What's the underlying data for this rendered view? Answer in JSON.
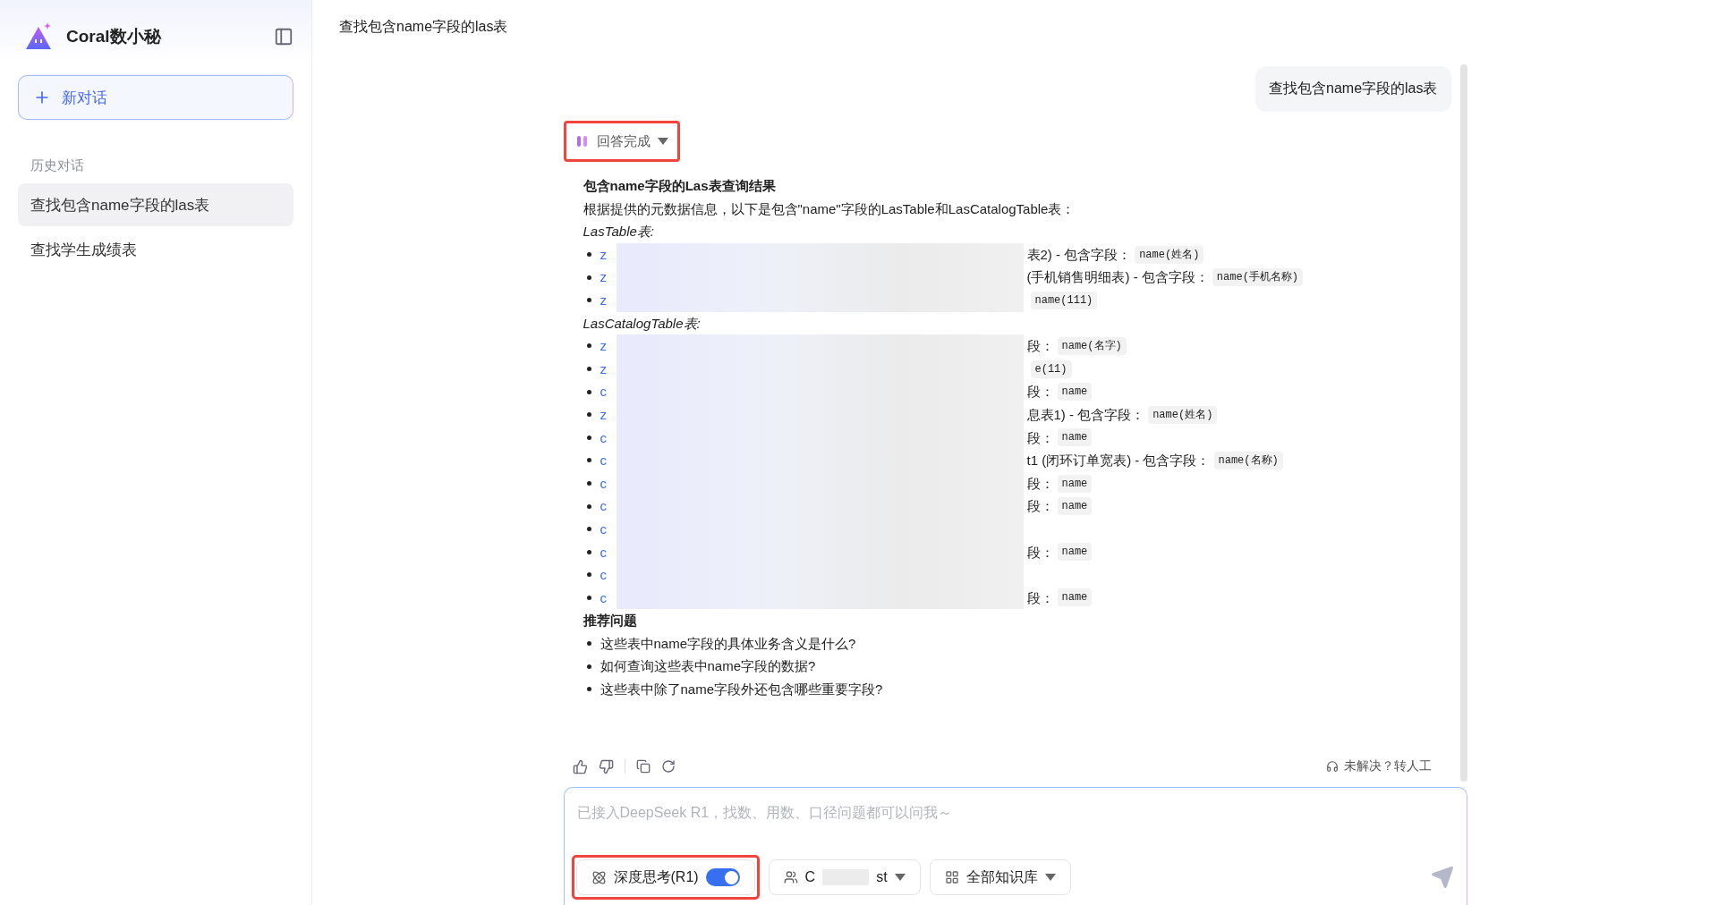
{
  "sidebar": {
    "app_name": "Coral数小秘",
    "new_chat": "新对话",
    "history_label": "历史对话",
    "history": [
      {
        "title": "查找包含name字段的las表",
        "selected": true
      },
      {
        "title": "查找学生成绩表",
        "selected": false
      }
    ]
  },
  "header": {
    "title": "查找包含name字段的las表"
  },
  "user_message": "查找包含name字段的las表",
  "answer": {
    "status": "回答完成",
    "status_highlighted": true,
    "heading": "包含name字段的Las表查询结果",
    "intro": "根据提供的元数据信息，以下是包含\"name\"字段的LasTable和LasCatalogTable表：",
    "sections": [
      {
        "title": "LasTable表:",
        "items": [
          {
            "link": "z",
            "tail": "表2) - 包含字段：",
            "code": "name(姓名)"
          },
          {
            "link": "z",
            "tail": "(手机销售明细表) - 包含字段：",
            "code": "name(手机名称)"
          },
          {
            "link": "z",
            "code": "name(111)"
          }
        ]
      },
      {
        "title": "LasCatalogTable表:",
        "items": [
          {
            "link": "z",
            "tail": "段：",
            "code": "name(名字)"
          },
          {
            "link": "z",
            "code": "e(11)"
          },
          {
            "link": "c",
            "tail": "段：",
            "code": "name"
          },
          {
            "link": "z",
            "tail": "息表1) - 包含字段：",
            "code": "name(姓名)"
          },
          {
            "link": "c",
            "tail": "段：",
            "code": "name"
          },
          {
            "link": "c",
            "tail": "t1 (闭环订单宽表) - 包含字段：",
            "code": "name(名称)"
          },
          {
            "link": "c",
            "tail": "段：",
            "code": "name"
          },
          {
            "link": "c",
            "tail": "段：",
            "code": "name"
          },
          {
            "link": "c"
          },
          {
            "link": "c",
            "tail": "段：",
            "code": "name"
          },
          {
            "link": "c"
          },
          {
            "link": "c",
            "tail": "段：",
            "code": "name"
          }
        ]
      }
    ],
    "recommend_title": "推荐问题",
    "recommendations": [
      "这些表中name字段的具体业务含义是什么?",
      "如何查询这些表中name字段的数据?",
      "这些表中除了name字段外还包含哪些重要字段?"
    ],
    "escalate": "未解决？转人工"
  },
  "composer": {
    "placeholder": "已接入DeepSeek R1，找数、用数、口径问题都可以问我～",
    "deep_think": {
      "label": "深度思考(R1)",
      "on": true,
      "highlighted": true
    },
    "user_select": {
      "prefix": "C",
      "suffix": "st"
    },
    "knowledge": "全部知识库"
  }
}
